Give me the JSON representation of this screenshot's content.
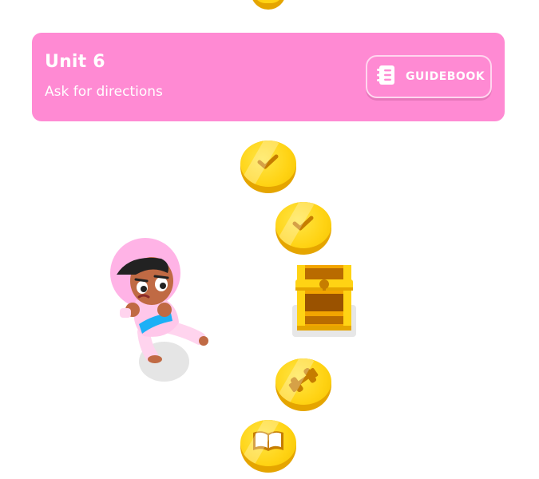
{
  "unit": {
    "title": "Unit 6",
    "subtitle": "Ask for directions",
    "guidebook_label": "GUIDEBOOK"
  },
  "path": {
    "nodes": [
      {
        "type": "lesson",
        "state": "completed",
        "icon": "check-icon"
      },
      {
        "type": "lesson",
        "state": "completed",
        "icon": "check-icon"
      },
      {
        "type": "chest",
        "state": "locked",
        "icon": "treasure-chest-icon"
      },
      {
        "type": "practice",
        "state": "available",
        "icon": "dumbbell-icon"
      },
      {
        "type": "story",
        "state": "available",
        "icon": "book-icon"
      }
    ]
  },
  "colors": {
    "banner": "#ff8ad3",
    "coin_gold": "#ffd314",
    "coin_shade": "#e5a500",
    "icon_brown": "#c67d00"
  }
}
